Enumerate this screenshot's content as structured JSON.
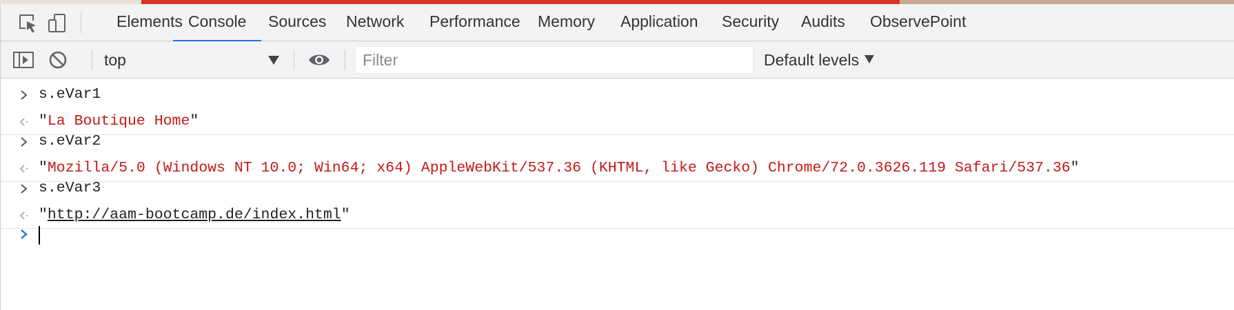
{
  "devtools": {
    "tabs": [
      {
        "label": "Elements"
      },
      {
        "label": "Console"
      },
      {
        "label": "Sources"
      },
      {
        "label": "Network"
      },
      {
        "label": "Performance"
      },
      {
        "label": "Memory"
      },
      {
        "label": "Application"
      },
      {
        "label": "Security"
      },
      {
        "label": "Audits"
      },
      {
        "label": "ObservePoint"
      }
    ],
    "active_tab": "Console",
    "toolbar_icons": [
      "inspect-element-icon",
      "device-toggle-icon"
    ]
  },
  "console_toolbar": {
    "icons": [
      "sidebar-toggle-icon",
      "clear-console-icon",
      "live-expression-eye-icon"
    ],
    "context": "top",
    "filter_placeholder": "Filter",
    "levels_label": "Default levels"
  },
  "console": {
    "entries": [
      {
        "input": "s.eVar1",
        "result_quote_open": "\"",
        "result": "La Boutique Home",
        "result_quote_close": "\"",
        "result_kind": "string"
      },
      {
        "input": "s.eVar2",
        "result_quote_open": "\"",
        "result": "Mozilla/5.0 (Windows NT 10.0; Win64; x64) AppleWebKit/537.36 (KHTML, like Gecko) Chrome/72.0.3626.119 Safari/537.36",
        "result_quote_close": "\"",
        "result_kind": "string"
      },
      {
        "input": "s.eVar3",
        "result_quote_open": "\"",
        "result": "http://aam-bootcamp.de/index.html",
        "result_quote_close": "\"",
        "result_kind": "link"
      }
    ],
    "prompt_value": "",
    "colors": {
      "string": "#c41a16",
      "active_tab_underline": "#1a73e8",
      "prompt_chevron": "#1a73e8"
    }
  }
}
